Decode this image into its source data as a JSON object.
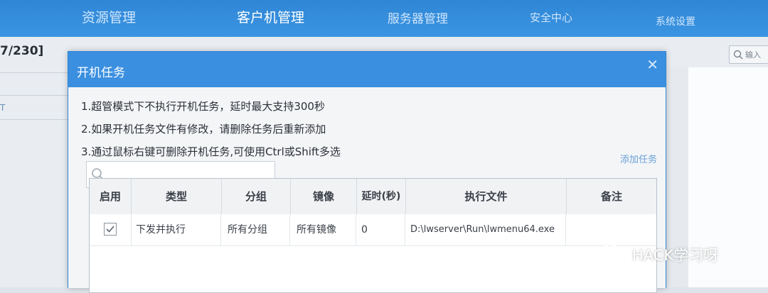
{
  "nav": {
    "items": [
      {
        "label": "资源管理"
      },
      {
        "label": "客户机管理"
      },
      {
        "label": "服务器管理"
      },
      {
        "label": "安全中心"
      },
      {
        "label": "系统设置"
      }
    ]
  },
  "background": {
    "count_label": "7/230]",
    "side_mark": "T",
    "search_placeholder": "输入"
  },
  "dialog": {
    "title": "开机任务",
    "notes": [
      "1.超管模式下不执行开机任务，延时最大支持300秒",
      "2.如果开机任务文件有修改，请删除任务后重新添加",
      "3.通过鼠标右键可删除开机任务,可使用Ctrl或Shift多选"
    ],
    "add_task_label": "添加任务",
    "table": {
      "columns": [
        "启用",
        "类型",
        "分组",
        "镜像",
        "延时(秒)",
        "执行文件",
        "备注"
      ],
      "rows": [
        {
          "enabled": true,
          "type": "下发并执行",
          "group": "所有分组",
          "image": "所有镜像",
          "delay": "0",
          "file": "D:\\lwserver\\Run\\lwmenu64.exe",
          "note": ""
        }
      ]
    }
  },
  "watermark": {
    "text": "HACK学习呀"
  },
  "colors": {
    "nav_bg": "#3b95e2",
    "dialog_header": "#3a8fe0",
    "link": "#6aa0d8"
  }
}
